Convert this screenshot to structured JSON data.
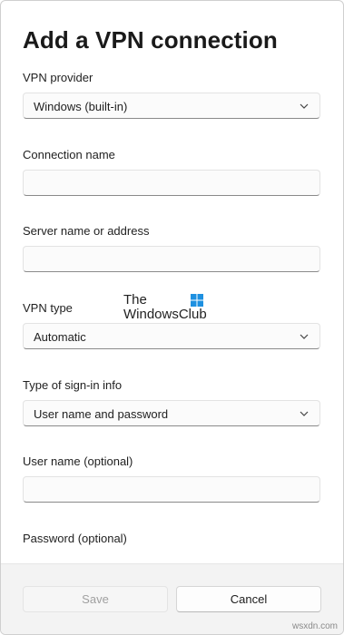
{
  "dialog": {
    "title": "Add a VPN connection",
    "vpn_provider": {
      "label": "VPN provider",
      "value": "Windows (built-in)"
    },
    "connection_name": {
      "label": "Connection name",
      "value": ""
    },
    "server": {
      "label": "Server name or address",
      "value": ""
    },
    "vpn_type": {
      "label": "VPN type",
      "value": "Automatic"
    },
    "sign_in_type": {
      "label": "Type of sign-in info",
      "value": "User name and password"
    },
    "username": {
      "label": "User name (optional)",
      "value": ""
    },
    "password": {
      "label": "Password (optional)"
    }
  },
  "footer": {
    "save_label": "Save",
    "cancel_label": "Cancel"
  },
  "watermark": {
    "line1": "The",
    "line2": "WindowsClub",
    "logo_color": "#1e90e0"
  },
  "credit": "wsxdn.com",
  "icons": {
    "dropdown": "chevron-down-icon",
    "logo": "windows-logo-icon"
  }
}
